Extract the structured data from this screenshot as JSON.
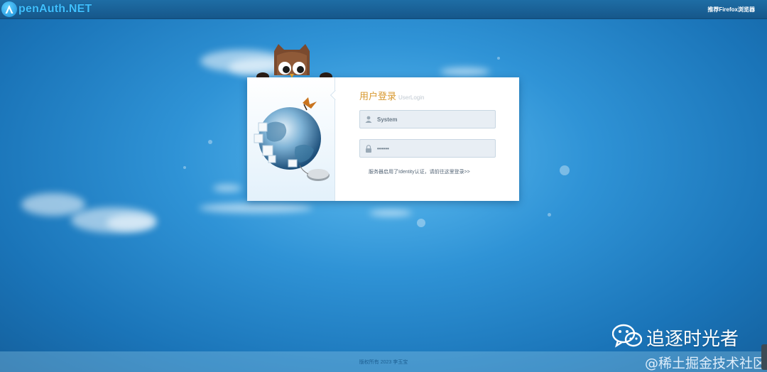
{
  "header": {
    "logo_letter": "A",
    "logo_text": "penAuth.NET",
    "browser_tip": "推荐Firefox浏览器"
  },
  "login": {
    "title_cn": "用户登录",
    "title_en": "UserLogin",
    "username_value": "System",
    "password_value": "123456",
    "hint": "服务器启用了Identity认证，请前往这里登录>>"
  },
  "footer": {
    "copyright": "版权所有 2023 李玉宝"
  },
  "watermark": {
    "wechat_label": "追逐时光者",
    "juejin_label": "@稀土掘金技术社区"
  },
  "colors": {
    "accent_title": "#d8982e",
    "logo_blue": "#3fc0ff",
    "background": "#2f93d6"
  },
  "icons": {
    "user": "user-icon",
    "lock": "lock-icon",
    "wechat": "wechat-icon"
  }
}
